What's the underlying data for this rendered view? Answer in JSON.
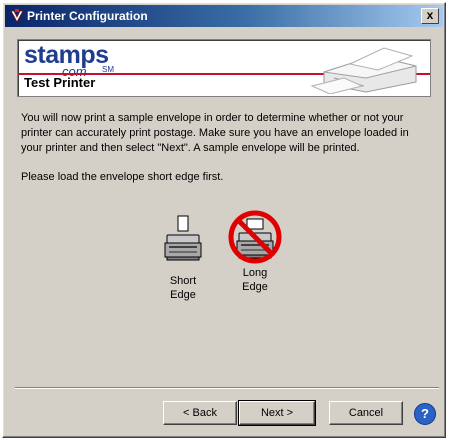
{
  "window": {
    "title": "Printer Configuration",
    "close_label": "x"
  },
  "banner": {
    "logo_main": "stamps",
    "logo_sub": "com",
    "logo_tm": "SM",
    "heading": "Test Printer"
  },
  "content": {
    "instructions": "You will now print a sample envelope in order to determine whether or not your printer can accurately print postage.  Make sure you have an envelope loaded in your printer and then select \"Next\".  A sample envelope will be printed.",
    "load_instruction": "Please load the envelope short edge first."
  },
  "options": {
    "short_edge_line1": "Short",
    "short_edge_line2": "Edge",
    "long_edge_line1": "Long",
    "long_edge_line2": "Edge"
  },
  "buttons": {
    "back": "< Back",
    "next": "Next >",
    "cancel": "Cancel",
    "help": "?"
  },
  "colors": {
    "title_bar": "#0a246a",
    "brand_blue": "#1e3d8f",
    "brand_red": "#c8102e",
    "prohibit_red": "#e00000"
  }
}
